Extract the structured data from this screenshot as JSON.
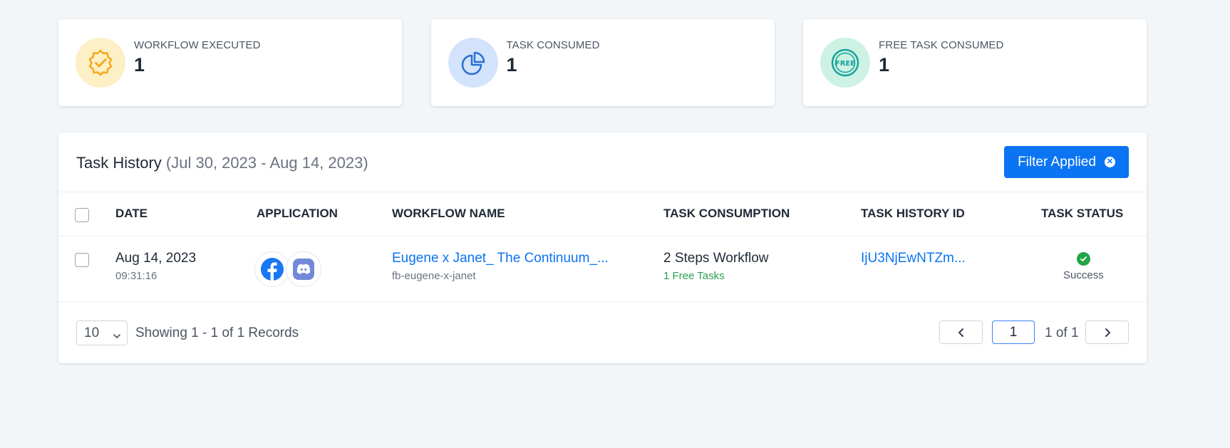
{
  "stats": [
    {
      "label": "WORKFLOW EXECUTED",
      "value": "1",
      "icon": "badge-check-icon",
      "color": "#f4a91b"
    },
    {
      "label": "TASK CONSUMED",
      "value": "1",
      "icon": "pie-chart-icon",
      "color": "#2b6fd6"
    },
    {
      "label": "FREE TASK CONSUMED",
      "value": "1",
      "icon": "free-badge-icon",
      "color": "#16a39a"
    }
  ],
  "history": {
    "title": "Task History",
    "range": "(Jul 30, 2023 - Aug 14, 2023)",
    "filter_label": "Filter Applied"
  },
  "table": {
    "columns": [
      "DATE",
      "APPLICATION",
      "WORKFLOW NAME",
      "TASK CONSUMPTION",
      "TASK HISTORY ID",
      "TASK STATUS"
    ],
    "rows": [
      {
        "date": "Aug 14, 2023",
        "time": "09:31:16",
        "apps": [
          "facebook-icon",
          "discord-icon"
        ],
        "workflow_name": "Eugene x Janet_ The Continuum_...",
        "workflow_slug": "fb-eugene-x-janet",
        "consumption": "2 Steps Workflow",
        "free_tasks": "1 Free Tasks",
        "history_id": "IjU3NjEwNTZm...",
        "status": "Success"
      }
    ]
  },
  "pagination": {
    "page_size": "10",
    "showing": "Showing 1 - 1 of 1 Records",
    "current_page": "1",
    "of_text": "1 of 1"
  }
}
